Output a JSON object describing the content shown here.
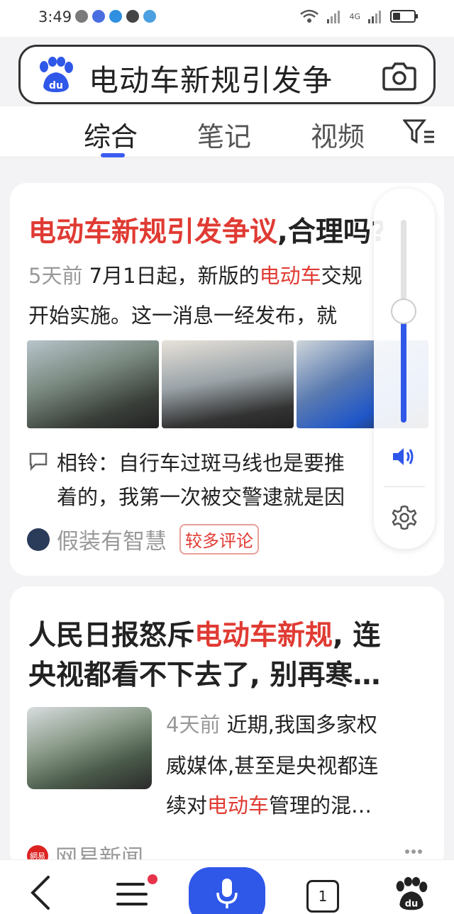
{
  "status_bar": {
    "time": "3:49",
    "network": "4G"
  },
  "search": {
    "query": "电动车新规引发争"
  },
  "tabs": [
    {
      "label": "综合",
      "active": true
    },
    {
      "label": "笔记",
      "active": false
    },
    {
      "label": "视频",
      "active": false
    }
  ],
  "card1": {
    "title_red": "电动车新规引发争议",
    "title_rest": ",合理吗?",
    "time": "5天前",
    "snippet_line1_a": " 7月1日起，新版的",
    "snippet_line1_red": "电动车",
    "snippet_line1_b": "交规",
    "snippet_line2": "开始实施。这一消息一经发布，就",
    "comment_line1": "相铃：自行车过斑马线也是要推",
    "comment_line2": "着的，我第一次被交警逮就是因",
    "author": "假装有智慧",
    "badge": "较多评论"
  },
  "card2": {
    "title_line1_a": "人民日报怒斥",
    "title_line1_red": "电动车新规",
    "title_line1_b": ", 连",
    "title_line2": "央视都看不下去了, 别再寒…",
    "time": "4天前",
    "snippet_line1": " 近期,我国多家权",
    "snippet_line2": "威媒体,甚至是央视都连",
    "snippet_line3_a": "续对",
    "snippet_line3_red": "电动车",
    "snippet_line3_b": "管理的混…",
    "source": "网易新闻",
    "source_icon_text": "網易"
  },
  "volume": {
    "level": 0.55
  },
  "bottom_nav": {
    "tab_count": "1"
  },
  "colors": {
    "accent": "#2f57e8",
    "highlight_red": "#e03b33"
  }
}
